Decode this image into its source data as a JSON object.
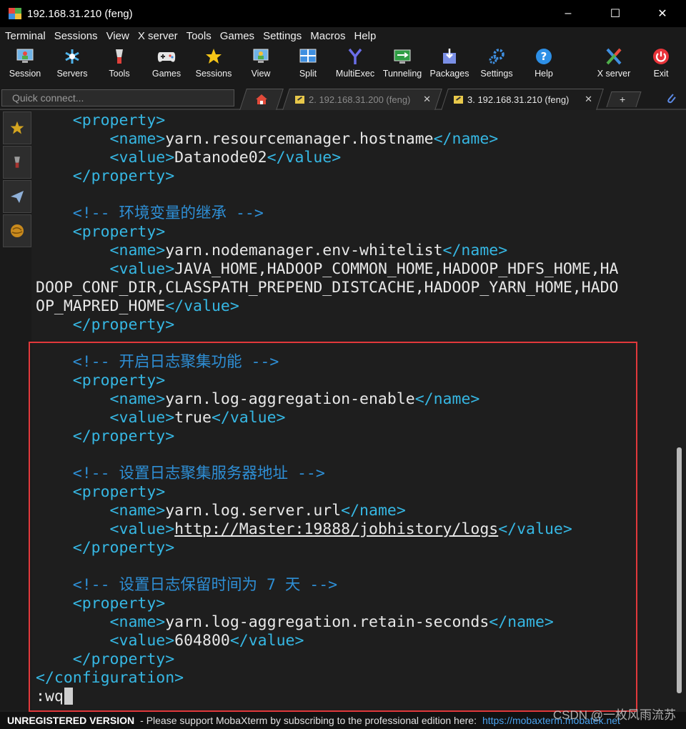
{
  "window": {
    "title": "192.168.31.210 (feng)",
    "controls": [
      "–",
      "☐",
      "✕"
    ]
  },
  "menu": [
    "Terminal",
    "Sessions",
    "View",
    "X server",
    "Tools",
    "Games",
    "Settings",
    "Macros",
    "Help"
  ],
  "toolbar": [
    {
      "label": "Session",
      "icon": "session-icon"
    },
    {
      "label": "Servers",
      "icon": "servers-icon"
    },
    {
      "label": "Tools",
      "icon": "tools-icon"
    },
    {
      "label": "Games",
      "icon": "games-icon"
    },
    {
      "label": "Sessions",
      "icon": "star-icon"
    },
    {
      "label": "View",
      "icon": "view-icon"
    },
    {
      "label": "Split",
      "icon": "split-icon"
    },
    {
      "label": "MultiExec",
      "icon": "multiexec-icon"
    },
    {
      "label": "Tunneling",
      "icon": "tunneling-icon"
    },
    {
      "label": "Packages",
      "icon": "packages-icon"
    },
    {
      "label": "Settings",
      "icon": "settings-icon"
    },
    {
      "label": "Help",
      "icon": "help-icon"
    },
    {
      "label": "X server",
      "icon": "x-server-icon"
    },
    {
      "label": "Exit",
      "icon": "exit-icon"
    }
  ],
  "quick_connect": {
    "placeholder": "Quick connect..."
  },
  "tabs": [
    {
      "label": "2. 192.168.31.200 (feng)",
      "close": "✕",
      "active": false
    },
    {
      "label": "3. 192.168.31.210 (feng)",
      "close": "✕",
      "active": true
    }
  ],
  "new_tab": "+",
  "terminal": {
    "lines": [
      "    <property>",
      "        <name>yarn.resourcemanager.hostname</name>",
      "        <value>Datanode02</value>",
      "    </property>",
      "",
      "    <!-- 环境变量的继承 -->",
      "    <property>",
      "        <name>yarn.nodemanager.env-whitelist</name>",
      "        <value>JAVA_HOME,HADOOP_COMMON_HOME,HADOOP_HDFS_HOME,HA",
      "DOOP_CONF_DIR,CLASSPATH_PREPEND_DISTCACHE,HADOOP_YARN_HOME,HADO",
      "OP_MAPRED_HOME</value>",
      "    </property>",
      "",
      "    <!-- 开启日志聚集功能 -->",
      "    <property>",
      "        <name>yarn.log-aggregation-enable</name>",
      "        <value>true</value>",
      "    </property>",
      "",
      "    <!-- 设置日志聚集服务器地址 -->",
      "    <property>",
      "        <name>yarn.log.server.url</name>",
      "        <value>http://Master:19888/jobhistory/logs</value>",
      "    </property>",
      "",
      "    <!-- 设置日志保留时间为 7 天 -->",
      "    <property>",
      "        <name>yarn.log-aggregation.retain-seconds</name>",
      "        <value>604800</value>",
      "    </property>",
      "</configuration>",
      ":wq"
    ]
  },
  "status": {
    "unregistered": "UNREGISTERED VERSION",
    "message": "-  Please support MobaXterm by subscribing to the professional edition here:",
    "link": "https://mobaxterm.mobatek.net"
  },
  "watermark": "CSDN @一枚风雨流苏",
  "colors": {
    "tag": "#36b7e3",
    "comment": "#2e8fd6",
    "text": "#e8e8e8",
    "highlight": "#e1383b"
  }
}
